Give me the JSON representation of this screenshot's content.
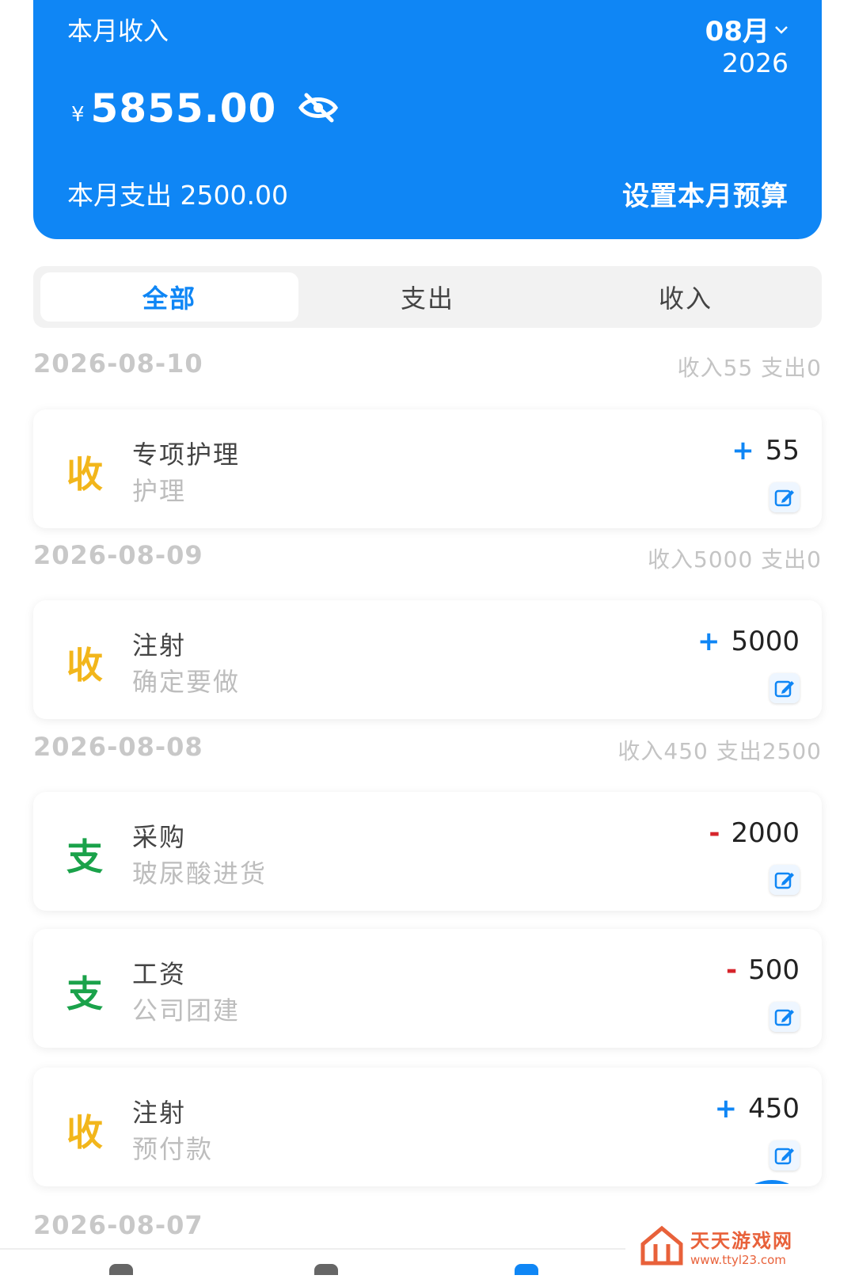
{
  "summary": {
    "income_label": "本月收入",
    "month": "08月",
    "year": "2026",
    "currency": "¥",
    "amount": "5855.00",
    "expense_text": "本月支出 2500.00",
    "budget_link": "设置本月预算",
    "accent_color": "#0f86f5"
  },
  "tabs": [
    {
      "label": "全部",
      "active": true
    },
    {
      "label": "支出",
      "active": false
    },
    {
      "label": "收入",
      "active": false
    }
  ],
  "groups": [
    {
      "date": "2026-08-10",
      "summary": "收入55  支出0"
    },
    {
      "date": "2026-08-09",
      "summary": "收入5000  支出0"
    },
    {
      "date": "2026-08-08",
      "summary": "收入450  支出2500"
    },
    {
      "date": "2026-08-07",
      "summary": ""
    }
  ],
  "records": [
    {
      "badge": "收",
      "title": "专项护理",
      "note": "护理",
      "sign": "+",
      "amount": "55"
    },
    {
      "badge": "收",
      "title": "注射",
      "note": "确定要做",
      "sign": "+",
      "amount": "5000"
    },
    {
      "badge": "支",
      "title": "采购",
      "note": "玻尿酸进货",
      "sign": "-",
      "amount": "2000"
    },
    {
      "badge": "支",
      "title": "工资",
      "note": "公司团建",
      "sign": "-",
      "amount": "500"
    },
    {
      "badge": "收",
      "title": "注射",
      "note": "预付款",
      "sign": "+",
      "amount": "450"
    }
  ],
  "fab": {
    "label": "+"
  },
  "watermark": {
    "name": "天天游戏网",
    "url": "www.ttyl23.com"
  },
  "icons": {
    "month_dropdown": "chevron-down-icon",
    "hide_amount": "eye-off-icon",
    "edit": "edit-icon",
    "add": "plus-icon"
  }
}
